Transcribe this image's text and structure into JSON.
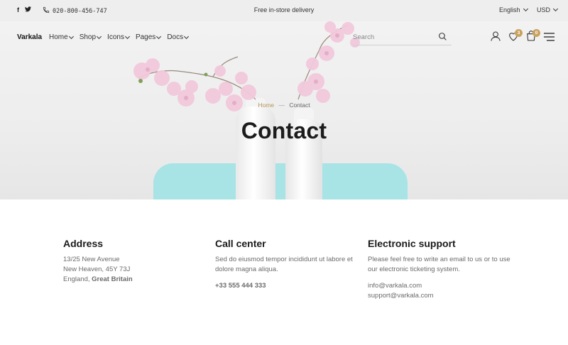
{
  "topbar": {
    "social": [
      "f",
      "t"
    ],
    "phone": "020-800-456-747",
    "promo": "Free in-store delivery",
    "language": "English",
    "currency": "USD"
  },
  "header": {
    "logo": "Varkala",
    "nav": [
      {
        "label": "Home"
      },
      {
        "label": "Shop"
      },
      {
        "label": "Icons"
      },
      {
        "label": "Pages"
      },
      {
        "label": "Docs"
      }
    ],
    "search_placeholder": "Search",
    "wishlist_count": "3",
    "cart_count": "0"
  },
  "breadcrumb": {
    "home": "Home",
    "separator": "—",
    "current": "Contact"
  },
  "page_title": "Contact",
  "info": {
    "address": {
      "heading": "Address",
      "line1": "13/25 New Avenue",
      "line2": "New Heaven, 45Y 73J",
      "line3_prefix": "England, ",
      "line3_bold": "Great Britain"
    },
    "call": {
      "heading": "Call center",
      "text": "Sed do eiusmod tempor incididunt ut labore et dolore magna aliqua.",
      "phone": "+33 555 444 333"
    },
    "support": {
      "heading": "Electronic support",
      "text": "Please feel free to write an email to us or to use our electronic ticketing system.",
      "email1": "info@varkala.com",
      "email2": "support@varkala.com"
    }
  },
  "colors": {
    "accent": "#c9a25f",
    "chair": "#a8e3e6",
    "topbar": "#eeeeee"
  }
}
